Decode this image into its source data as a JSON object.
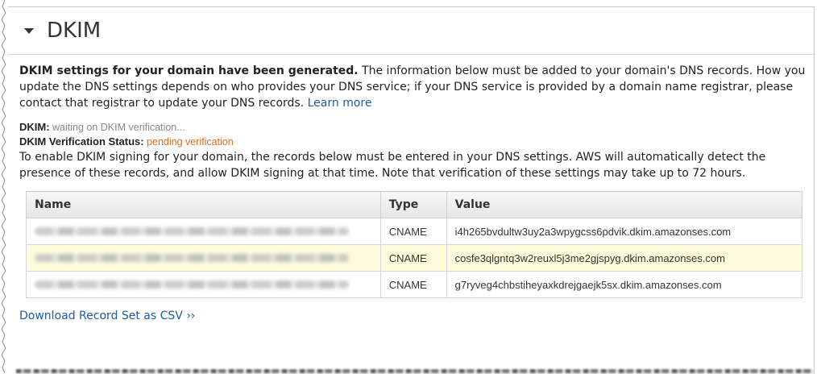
{
  "section": {
    "title": "DKIM"
  },
  "message": {
    "bold": "DKIM settings for your domain have been generated.",
    "rest": " The information below must be added to your domain's DNS records. How you update the DNS settings depends on who provides your DNS service; if your DNS service is provided by a domain name registrar, please contact that registrar to update your DNS records. ",
    "learn_more": "Learn more"
  },
  "status": {
    "dkim_label": "DKIM:",
    "dkim_value": " waiting on DKIM verification...",
    "verification_label": "DKIM Verification Status:",
    "verification_value": " pending verification"
  },
  "instructions": "To enable DKIM signing for your domain, the records below must be entered in your DNS settings. AWS will automatically detect the presence of these records, and allow DKIM signing at that time. Note that verification of these settings may take up to 72 hours.",
  "table": {
    "headers": [
      "Name",
      "Type",
      "Value"
    ],
    "rows": [
      {
        "type": "CNAME",
        "value": "i4h265bvdultw3uy2a3wpygcss6pdvik.dkim.amazonses.com"
      },
      {
        "type": "CNAME",
        "value": "cosfe3qlgntq3w2reuxl5j3me2gjspyg.dkim.amazonses.com"
      },
      {
        "type": "CNAME",
        "value": "g7ryveg4chbstiheyaxkdrejgaejk5sx.dkim.amazonses.com"
      }
    ]
  },
  "download": {
    "label": "Download Record Set as CSV ››"
  },
  "colors": {
    "link": "#1f5aa6",
    "pending": "#e06c1c",
    "highlight_row": "#fcfbdc"
  }
}
